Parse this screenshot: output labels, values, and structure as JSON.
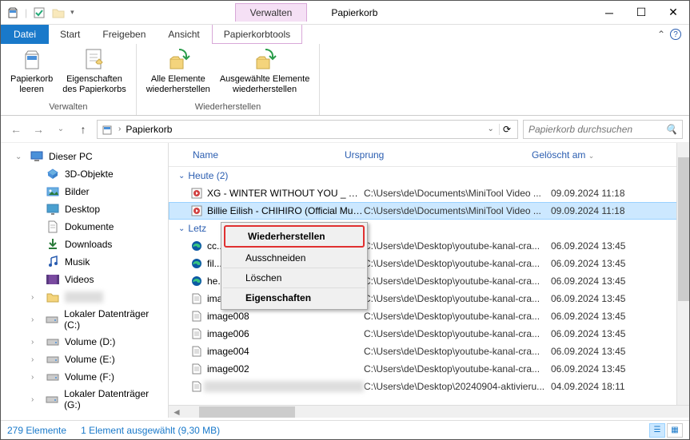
{
  "window": {
    "title": "Papierkorb"
  },
  "qat": {
    "manage_tab": "Verwalten"
  },
  "tabs": {
    "file": "Datei",
    "start": "Start",
    "share": "Freigeben",
    "view": "Ansicht",
    "tools": "Papierkorbtools"
  },
  "ribbon": {
    "manage": {
      "label": "Verwalten",
      "empty": "Papierkorb\nleeren",
      "properties": "Eigenschaften\ndes Papierkorbs"
    },
    "restore": {
      "label": "Wiederherstellen",
      "all": "Alle Elemente\nwiederherstellen",
      "selected": "Ausgewählte Elemente\nwiederherstellen"
    }
  },
  "breadcrumb": {
    "location": "Papierkorb"
  },
  "search": {
    "placeholder": "Papierkorb durchsuchen"
  },
  "sidebar": {
    "this_pc": "Dieser PC",
    "items": [
      {
        "label": "3D-Objekte"
      },
      {
        "label": "Bilder"
      },
      {
        "label": "Desktop"
      },
      {
        "label": "Dokumente"
      },
      {
        "label": "Downloads"
      },
      {
        "label": "Musik"
      },
      {
        "label": "Videos"
      },
      {
        "label": ""
      },
      {
        "label": "Lokaler Datenträger (C:)"
      },
      {
        "label": "Volume (D:)"
      },
      {
        "label": "Volume (E:)"
      },
      {
        "label": "Volume (F:)"
      },
      {
        "label": "Lokaler Datenträger (G:)"
      }
    ]
  },
  "columns": {
    "name": "Name",
    "origin": "Ursprung",
    "deleted": "Gelöscht am"
  },
  "groups": {
    "today": "Heute (2)",
    "lastweek": "Letzte Woche"
  },
  "files": [
    {
      "name": "XG - WINTER WITHOUT YOU _ THE ...",
      "origin": "C:\\Users\\de\\Documents\\MiniTool Video ...",
      "deleted": "09.09.2024 11:18",
      "icon": "video",
      "group": "today"
    },
    {
      "name": "Billie Eilish - CHIHIRO (Official Mus...",
      "origin": "C:\\Users\\de\\Documents\\MiniTool Video ...",
      "deleted": "09.09.2024 11:18",
      "icon": "video",
      "group": "today",
      "selected": true
    },
    {
      "name": "cc...",
      "origin": "C:\\Users\\de\\Desktop\\youtube-kanal-cra...",
      "deleted": "06.09.2024 13:45",
      "icon": "edge",
      "group": "lastweek"
    },
    {
      "name": "fil...",
      "origin": "C:\\Users\\de\\Desktop\\youtube-kanal-cra...",
      "deleted": "06.09.2024 13:45",
      "icon": "edge",
      "group": "lastweek"
    },
    {
      "name": "he...",
      "origin": "C:\\Users\\de\\Desktop\\youtube-kanal-cra...",
      "deleted": "06.09.2024 13:45",
      "icon": "edge",
      "group": "lastweek"
    },
    {
      "name": "image",
      "origin": "C:\\Users\\de\\Desktop\\youtube-kanal-cra...",
      "deleted": "06.09.2024 13:45",
      "icon": "file",
      "group": "lastweek"
    },
    {
      "name": "image008",
      "origin": "C:\\Users\\de\\Desktop\\youtube-kanal-cra...",
      "deleted": "06.09.2024 13:45",
      "icon": "file",
      "group": "lastweek"
    },
    {
      "name": "image006",
      "origin": "C:\\Users\\de\\Desktop\\youtube-kanal-cra...",
      "deleted": "06.09.2024 13:45",
      "icon": "file",
      "group": "lastweek"
    },
    {
      "name": "image004",
      "origin": "C:\\Users\\de\\Desktop\\youtube-kanal-cra...",
      "deleted": "06.09.2024 13:45",
      "icon": "file",
      "group": "lastweek"
    },
    {
      "name": "image002",
      "origin": "C:\\Users\\de\\Desktop\\youtube-kanal-cra...",
      "deleted": "06.09.2024 13:45",
      "icon": "file",
      "group": "lastweek"
    },
    {
      "name": "",
      "origin": "C:\\Users\\de\\Desktop\\20240904-aktivieru...",
      "deleted": "04.09.2024 18:11",
      "icon": "file",
      "group": "lastweek",
      "blur": true
    }
  ],
  "context_menu": {
    "restore": "Wiederherstellen",
    "cut": "Ausschneiden",
    "delete": "Löschen",
    "properties": "Eigenschaften"
  },
  "statusbar": {
    "count": "279 Elemente",
    "selection": "1 Element ausgewählt (9,30 MB)"
  }
}
